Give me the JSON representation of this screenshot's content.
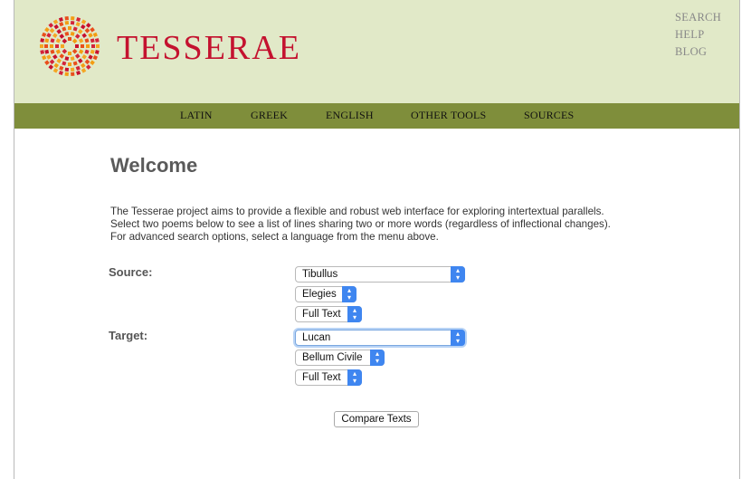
{
  "header": {
    "brand": "TESSERAE",
    "links": [
      "SEARCH",
      "HELP",
      "BLOG"
    ]
  },
  "nav": {
    "items": [
      "LATIN",
      "GREEK",
      "ENGLISH",
      "OTHER TOOLS",
      "SOURCES"
    ]
  },
  "main": {
    "title": "Welcome",
    "intro": [
      "The Tesserae project aims to provide a flexible and robust web interface for exploring intertextual parallels.",
      "Select two poems below to see a list of lines sharing two or more words (regardless of inflectional changes).",
      "For advanced search options, select a language from the menu above."
    ],
    "source": {
      "label": "Source:",
      "author": "Tibullus",
      "work": "Elegies",
      "unit": "Full Text"
    },
    "target": {
      "label": "Target:",
      "author": "Lucan",
      "work": "Bellum Civile",
      "unit": "Full Text"
    },
    "submit_label": "Compare Texts"
  },
  "colors": {
    "header_bg": "#e1e9c8",
    "nav_bg": "#7f8e3b",
    "brand_red": "#c4122f",
    "select_accent": "#3f86f0"
  },
  "icons": {
    "logo": "mosaic-circle-logo",
    "select_arrow": "chevron-up-down-icon"
  }
}
